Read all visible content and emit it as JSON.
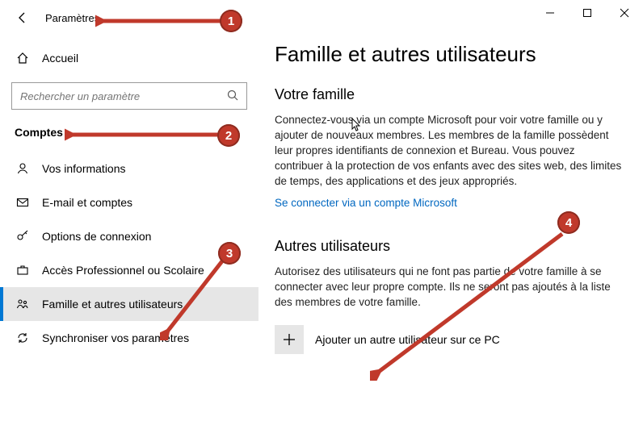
{
  "header": {
    "breadcrumb": "Paramètres"
  },
  "sidebar": {
    "home": "Accueil",
    "search_placeholder": "Rechercher un paramètre",
    "category": "Comptes",
    "items": [
      {
        "label": "Vos informations"
      },
      {
        "label": "E-mail et comptes"
      },
      {
        "label": "Options de connexion"
      },
      {
        "label": "Accès Professionnel ou Scolaire"
      },
      {
        "label": "Famille et autres utilisateurs"
      },
      {
        "label": "Synchroniser vos paramètres"
      }
    ]
  },
  "main": {
    "title": "Famille et autres utilisateurs",
    "family_heading": "Votre famille",
    "family_text": "Connectez-vous via un compte Microsoft pour voir votre famille ou y ajouter de nouveaux membres. Les membres de la famille possèdent leur propres identifiants de connexion et Bureau. Vous pouvez contribuer à la protection de vos enfants avec des sites web, des limites de temps, des applications et des jeux appropriés.",
    "signin_link": "Se connecter via un compte Microsoft",
    "others_heading": "Autres utilisateurs",
    "others_text": "Autorisez des utilisateurs qui ne font pas partie de votre famille à se connecter avec leur propre compte. Ils ne seront pas ajoutés à la liste des membres de votre famille.",
    "add_user": "Ajouter un autre utilisateur sur ce PC"
  },
  "callouts": {
    "1": "1",
    "2": "2",
    "3": "3",
    "4": "4"
  }
}
